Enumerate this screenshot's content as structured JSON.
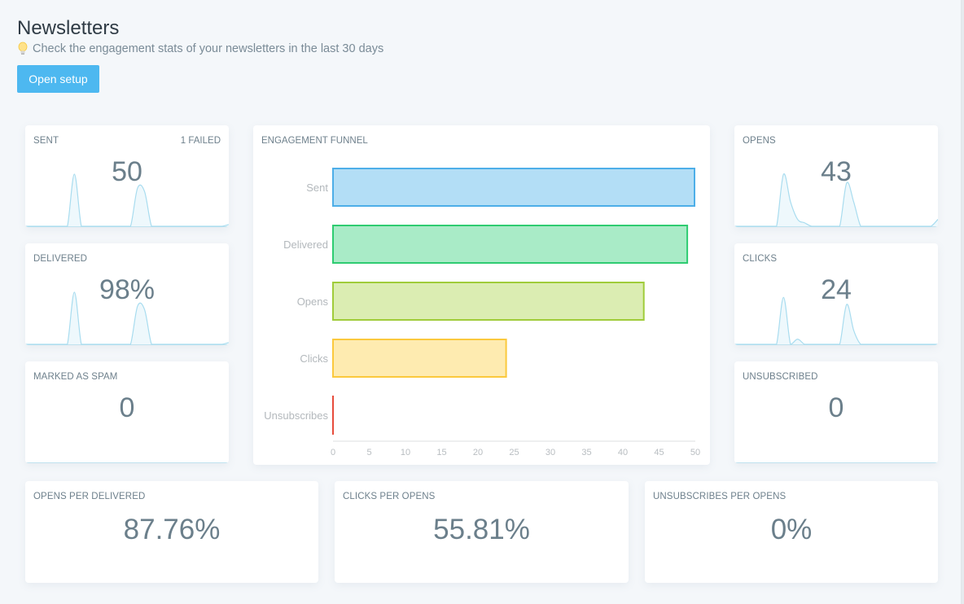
{
  "header": {
    "title": "Newsletters",
    "subtitle": "Check the engagement stats of your newsletters in the last 30 days",
    "subtitle_icon": "lightbulb-icon",
    "open_setup_label": "Open setup",
    "accent_color": "#4db8f0"
  },
  "cards": {
    "sent": {
      "label": "SENT",
      "aux": "1 FAILED",
      "value": "50"
    },
    "delivered": {
      "label": "DELIVERED",
      "value": "98%"
    },
    "spam": {
      "label": "MARKED AS SPAM",
      "value": "0"
    },
    "opens": {
      "label": "OPENS",
      "value": "43"
    },
    "clicks": {
      "label": "CLICKS",
      "value": "24"
    },
    "unsubscribed": {
      "label": "UNSUBSCRIBED",
      "value": "0"
    },
    "opens_per_delivered": {
      "label": "OPENS PER DELIVERED",
      "value": "87.76%"
    },
    "clicks_per_opens": {
      "label": "CLICKS PER OPENS",
      "value": "55.81%"
    },
    "unsubscribes_per_opens": {
      "label": "UNSUBSCRIBES PER OPENS",
      "value": "0%"
    }
  },
  "sparklines": {
    "color": "#a8dcef",
    "fill": "#eef8fc",
    "sent": [
      0,
      0,
      0,
      0,
      0,
      0,
      0,
      0,
      0,
      0,
      0,
      0,
      0,
      0,
      0,
      0,
      0,
      0,
      0,
      0,
      0,
      0,
      0,
      0,
      0,
      0,
      0,
      0,
      0,
      0,
      0,
      0,
      0,
      0,
      0,
      0,
      0,
      0,
      0,
      0,
      0,
      0,
      0,
      0,
      0,
      0,
      0,
      0,
      0,
      0,
      0,
      0,
      0,
      0,
      0,
      0,
      0,
      0,
      0,
      0,
      0,
      0,
      0,
      0,
      0,
      0,
      0,
      0,
      0,
      0,
      0,
      0,
      0,
      0,
      0,
      0,
      0,
      0,
      0,
      0,
      0,
      0,
      0,
      0,
      0,
      0,
      0,
      0,
      0,
      0,
      0,
      0,
      0,
      0,
      0,
      0,
      0,
      0,
      0,
      0
    ],
    "note": "sparklines rendered by script as relative daily series"
  },
  "funnel": {
    "title": "ENGAGEMENT FUNNEL"
  },
  "chart_data": {
    "type": "bar",
    "orientation": "horizontal",
    "title": "ENGAGEMENT FUNNEL",
    "categories": [
      "Sent",
      "Delivered",
      "Opens",
      "Clicks",
      "Unsubscribes"
    ],
    "values": [
      50,
      49,
      43,
      24,
      0
    ],
    "colors": {
      "fill": [
        "#b3def6",
        "#a9ebc7",
        "#dbedb2",
        "#feebb0",
        "#fbd0c8"
      ],
      "stroke": [
        "#4daee8",
        "#2ecc71",
        "#a0cc3a",
        "#fbc93d",
        "#e74c3c"
      ]
    },
    "xlim": [
      0,
      50
    ],
    "xticks": [
      0,
      5,
      10,
      15,
      20,
      25,
      30,
      35,
      40,
      45,
      50
    ],
    "xlabel": "",
    "ylabel": "",
    "grid": false,
    "legend": "none"
  },
  "sparkline_series": {
    "sent": [
      0,
      0,
      0,
      0,
      0,
      0,
      0,
      30,
      0,
      0,
      0,
      0,
      0,
      0,
      0,
      0,
      22,
      20,
      0,
      0,
      0,
      0,
      0,
      0,
      0,
      0,
      0,
      0,
      0,
      1
    ],
    "delivered": [
      0,
      0,
      0,
      0,
      0,
      0,
      0,
      30,
      0,
      0,
      0,
      0,
      0,
      0,
      0,
      0,
      22,
      20,
      0,
      0,
      0,
      0,
      0,
      0,
      0,
      0,
      0,
      0,
      0,
      1
    ],
    "opens": [
      0,
      0,
      0,
      0,
      0,
      0,
      0,
      30,
      14,
      4,
      2,
      0,
      0,
      0,
      0,
      0,
      25,
      14,
      0,
      0,
      0,
      0,
      0,
      0,
      0,
      0,
      0,
      0,
      0,
      4
    ],
    "clicks": [
      0,
      0,
      0,
      0,
      0,
      0,
      0,
      27,
      0,
      3,
      0,
      0,
      0,
      0,
      0,
      0,
      23,
      8,
      0,
      0,
      0,
      0,
      0,
      0,
      0,
      0,
      0,
      0,
      0,
      0
    ],
    "spam": [],
    "unsubscribed": []
  }
}
